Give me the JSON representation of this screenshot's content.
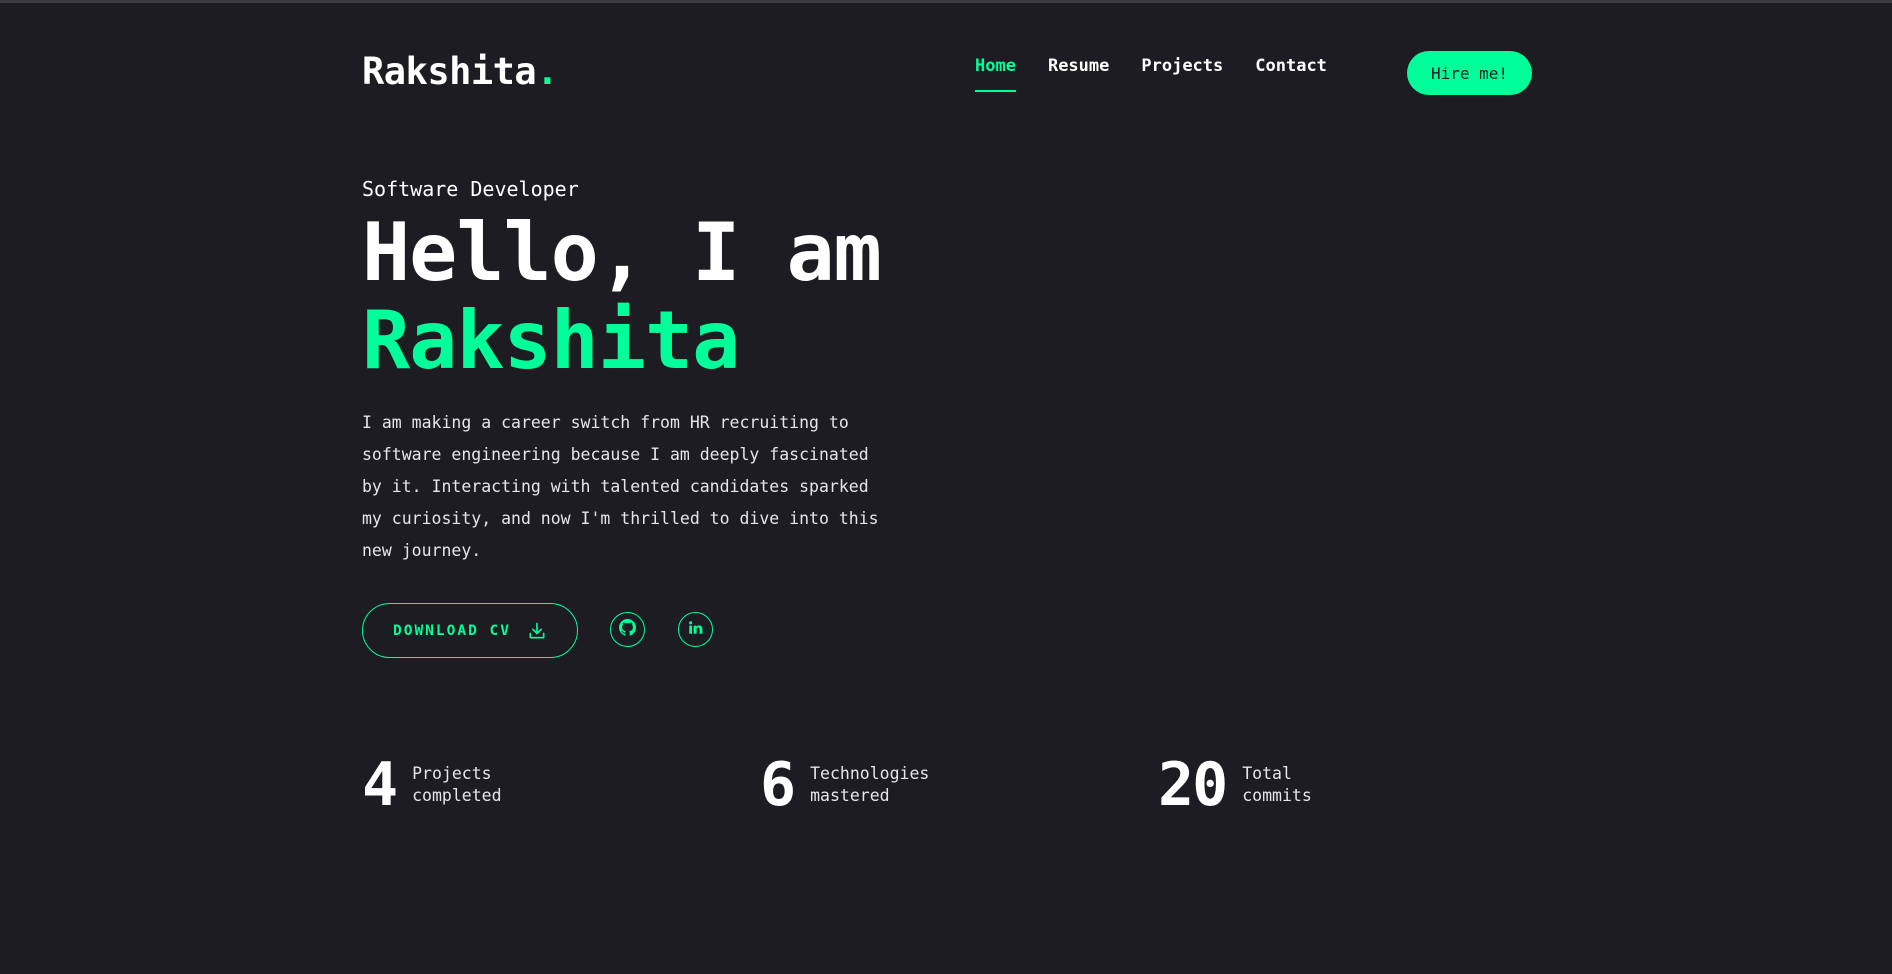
{
  "header": {
    "logo_text": "Rakshita",
    "logo_dot": ".",
    "nav": [
      {
        "label": "Home",
        "active": true
      },
      {
        "label": "Resume",
        "active": false
      },
      {
        "label": "Projects",
        "active": false
      },
      {
        "label": "Contact",
        "active": false
      }
    ],
    "hire_label": "Hire me!"
  },
  "hero": {
    "role": "Software Developer",
    "greeting": "Hello, I am",
    "name": "Rakshita",
    "bio": "I am making a career switch from HR recruiting to software engineering because I am deeply fascinated by it. Interacting with talented candidates sparked my curiosity, and now I'm thrilled to dive into this new journey.",
    "cv_label": "DOWNLOAD CV",
    "cv_icon": "download-icon",
    "socials": [
      {
        "icon": "github-icon"
      },
      {
        "icon": "linkedin-icon"
      }
    ]
  },
  "stats": [
    {
      "value": "4",
      "label_line1": "Projects",
      "label_line2": "completed"
    },
    {
      "value": "6",
      "label_line1": "Technologies",
      "label_line2": "mastered"
    },
    {
      "value": "20",
      "label_line1": "Total",
      "label_line2": "commits"
    }
  ],
  "colors": {
    "background": "#1c1c22",
    "accent": "#00ff99",
    "text": "#ffffff"
  }
}
